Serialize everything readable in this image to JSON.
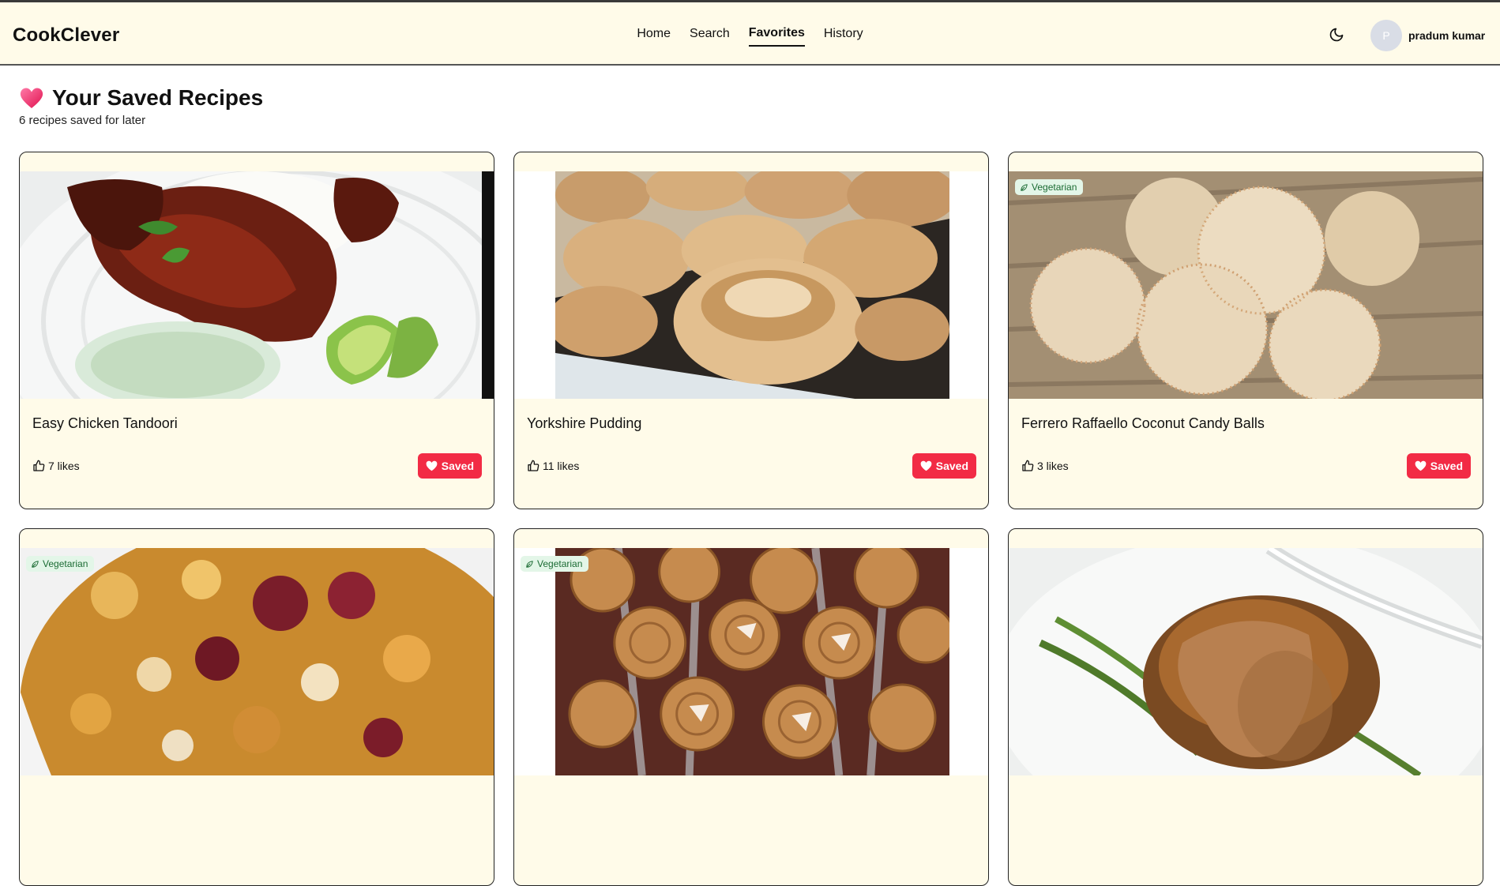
{
  "app": {
    "brand": "CookClever"
  },
  "nav": {
    "items": [
      {
        "label": "Home"
      },
      {
        "label": "Search"
      },
      {
        "label": "Favorites",
        "active": true
      },
      {
        "label": "History"
      }
    ]
  },
  "user": {
    "initial": "P",
    "name": "pradum kumar"
  },
  "icons": {
    "theme": "moon-icon",
    "title": "heart-emoji-icon",
    "likes": "thumbs-up-icon",
    "saved": "heart-icon",
    "vegetarian": "leaf-icon"
  },
  "colors": {
    "header_bg": "#fffbe9",
    "card_bg": "#fffbe9",
    "saved_button": "#f22b45",
    "veg_badge_bg": "#e3f6e8",
    "veg_badge_text": "#1b6b33"
  },
  "page": {
    "title": "Your Saved Recipes",
    "subtitle": "6 recipes saved for later"
  },
  "recipes": [
    {
      "title": "Easy Chicken Tandoori",
      "likes": "7 likes",
      "saved_label": "Saved",
      "badge": ""
    },
    {
      "title": "Yorkshire Pudding",
      "likes": "11 likes",
      "saved_label": "Saved",
      "badge": ""
    },
    {
      "title": "Ferrero Raffaello Coconut Candy Balls",
      "likes": "3 likes",
      "saved_label": "Saved",
      "badge": "Vegetarian"
    },
    {
      "title": "",
      "likes": "",
      "saved_label": "",
      "badge": "Vegetarian"
    },
    {
      "title": "",
      "likes": "",
      "saved_label": "",
      "badge": "Vegetarian"
    },
    {
      "title": "",
      "likes": "",
      "saved_label": "",
      "badge": ""
    }
  ]
}
